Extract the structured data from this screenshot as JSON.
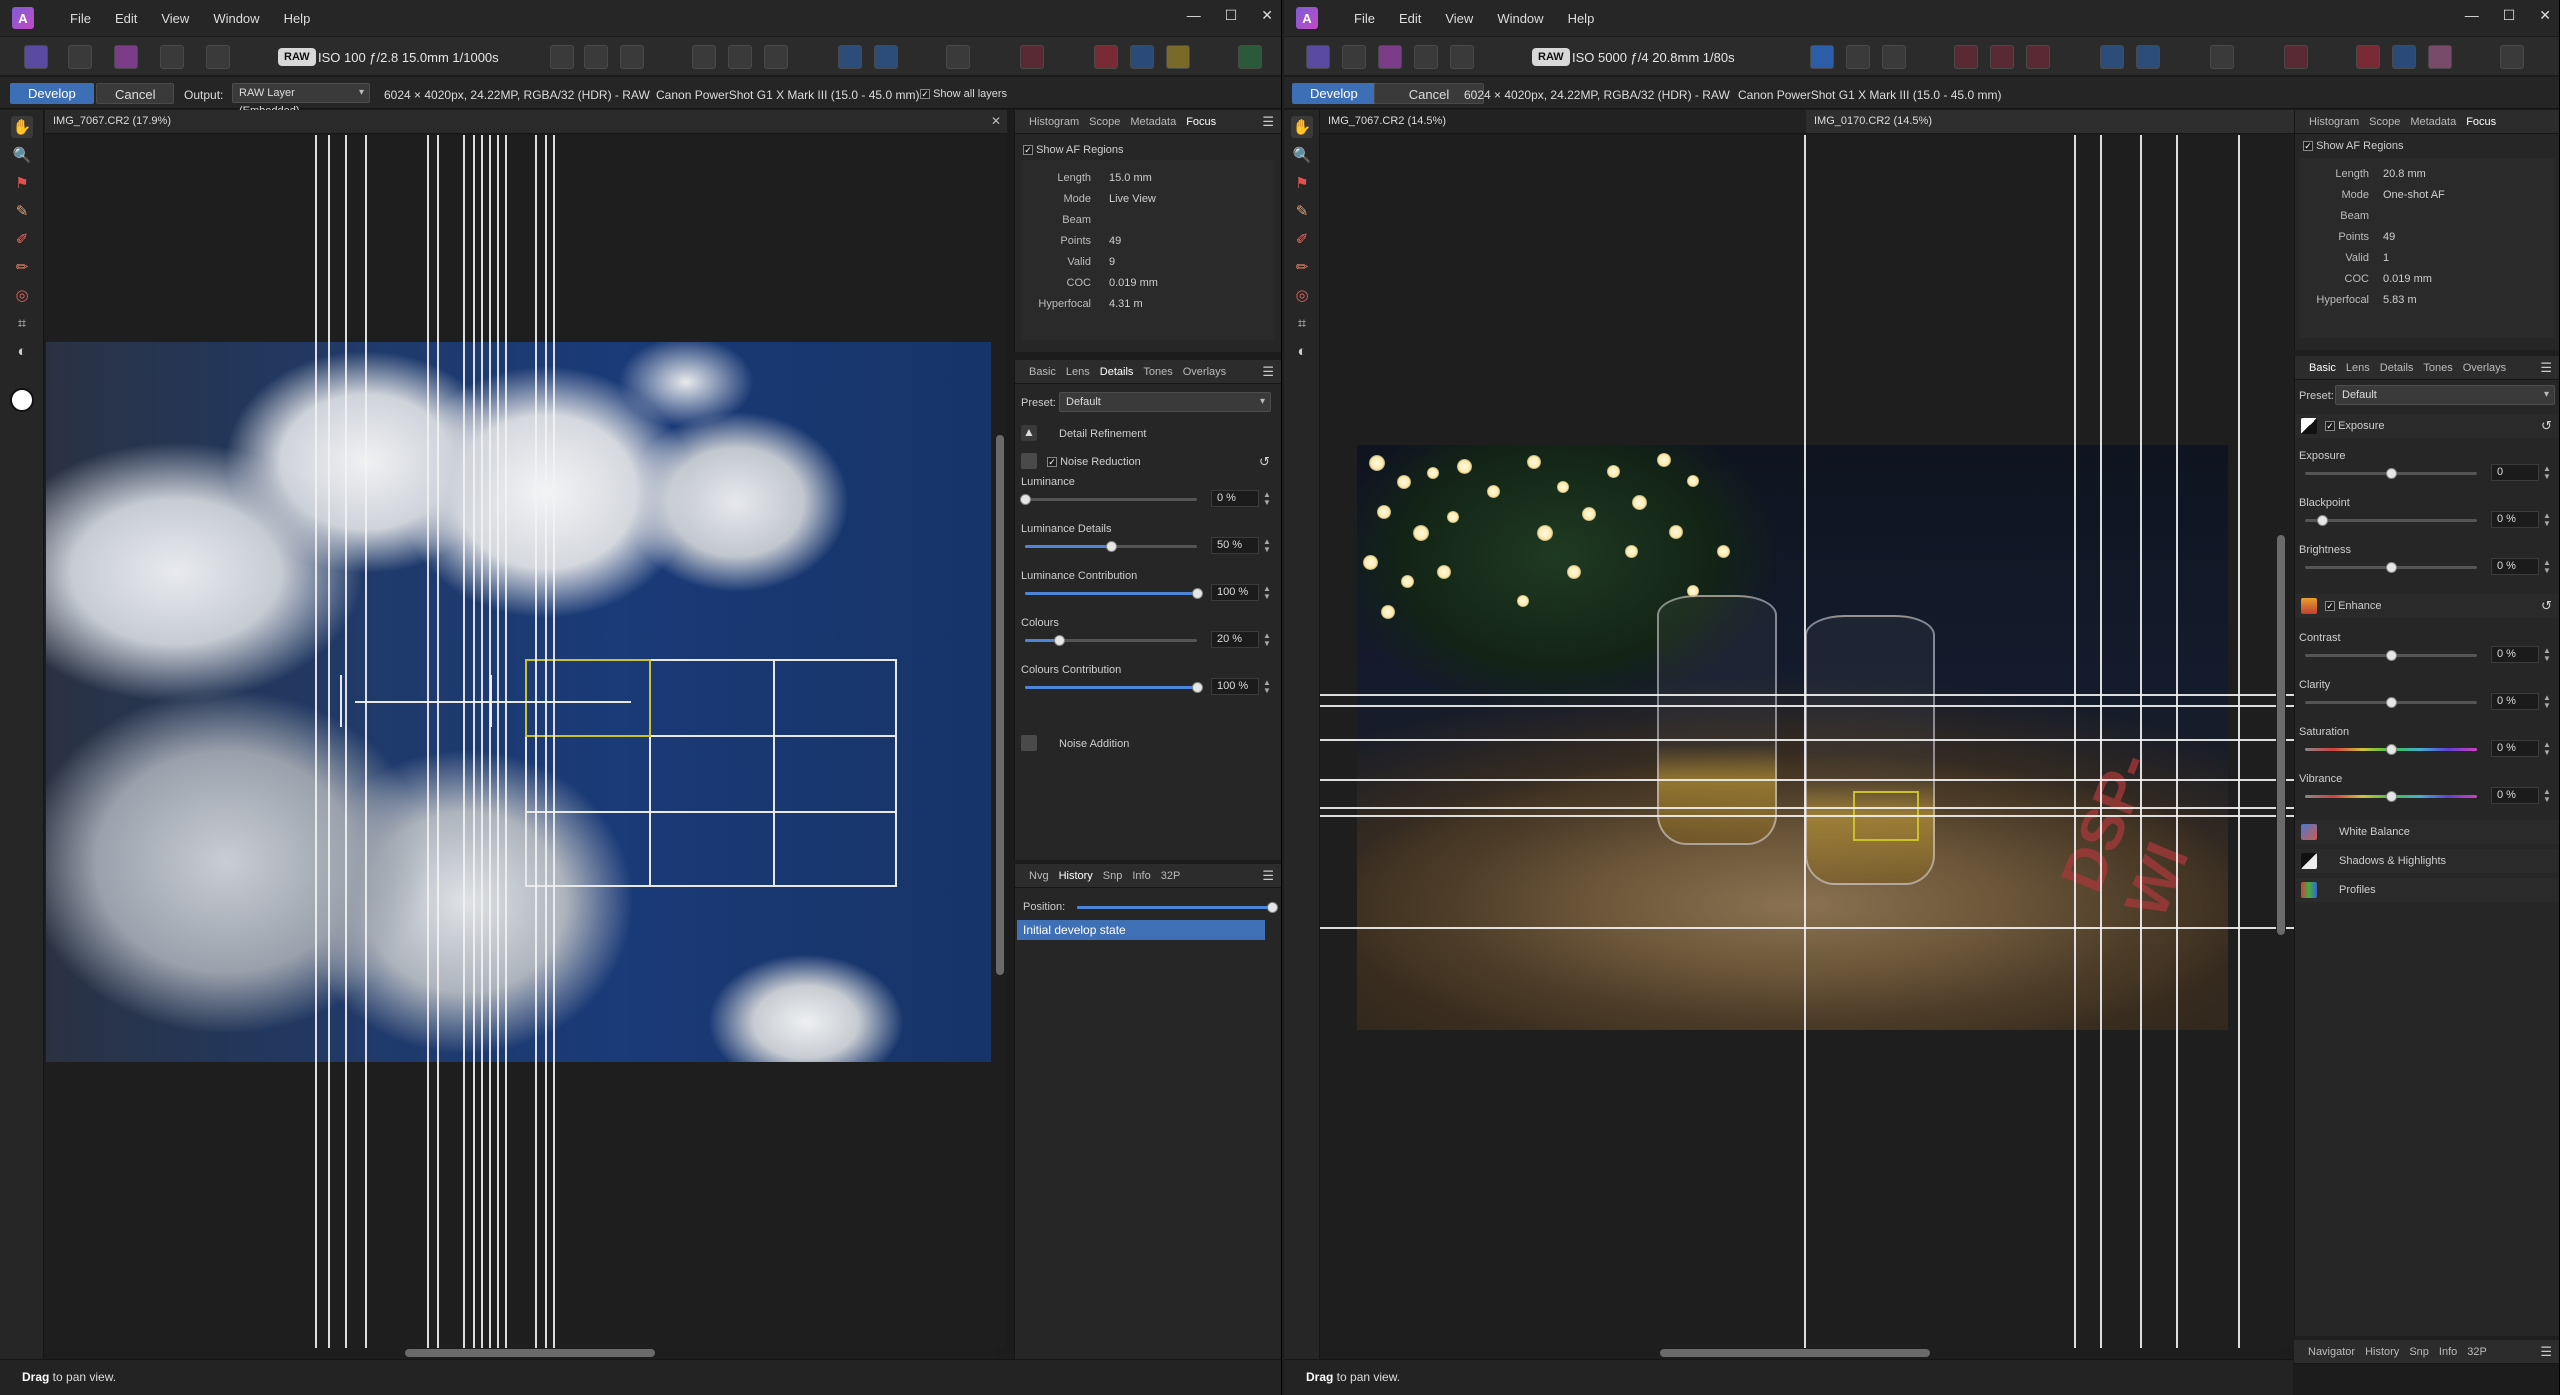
{
  "menu": [
    "File",
    "Edit",
    "View",
    "Window",
    "Help"
  ],
  "window_controls": {
    "minimize": "—",
    "maximize": "☐",
    "close": "✕"
  },
  "left": {
    "exif": "ISO 100 ƒ/2.8 15.0mm 1/1000s",
    "raw_badge": "RAW",
    "develop_label": "Develop",
    "cancel_label": "Cancel",
    "output_label": "Output:",
    "output_value": "RAW Layer (Embedded)",
    "image_info": "6024 × 4020px, 24.22MP, RGBA/32 (HDR) - RAW",
    "camera": "Canon PowerShot G1 X Mark III (15.0 - 45.0 mm)",
    "show_all_layers": "Show all layers",
    "doc_tab": "IMG_7067.CR2 (17.9%)",
    "status_bold": "Drag",
    "status_rest": " to pan view.",
    "top_tabs": [
      "Histogram",
      "Scope",
      "Metadata",
      "Focus"
    ],
    "show_af": "Show AF Regions",
    "focus": [
      {
        "k": "Length",
        "v": "15.0 mm"
      },
      {
        "k": "Mode",
        "v": "Live View"
      },
      {
        "k": "Beam",
        "v": ""
      },
      {
        "k": "Points",
        "v": "49"
      },
      {
        "k": "Valid",
        "v": "9"
      },
      {
        "k": "COC",
        "v": "0.019 mm"
      },
      {
        "k": "Hyperfocal",
        "v": "4.31 m"
      }
    ],
    "mid_tabs": [
      "Basic",
      "Lens",
      "Details",
      "Tones",
      "Overlays"
    ],
    "preset_label": "Preset:",
    "preset_value": "Default",
    "detail_refinement": "Detail Refinement",
    "noise_reduction": "Noise Reduction",
    "sliders": [
      {
        "label": "Luminance",
        "value": "0 %",
        "pos": 0.0
      },
      {
        "label": "Luminance Details",
        "value": "50 %",
        "pos": 0.5
      },
      {
        "label": "Luminance Contribution",
        "value": "100 %",
        "pos": 1.0
      },
      {
        "label": "Colours",
        "value": "20 %",
        "pos": 0.2
      },
      {
        "label": "Colours Contribution",
        "value": "100 %",
        "pos": 1.0
      }
    ],
    "noise_addition": "Noise Addition",
    "bottom_tabs": [
      "Nvg",
      "History",
      "Snp",
      "Info",
      "32P"
    ],
    "position_label": "Position:",
    "history_item": "Initial develop state"
  },
  "right": {
    "exif": "ISO 5000 ƒ/4 20.8mm 1/80s",
    "raw_badge": "RAW",
    "develop_label": "Develop",
    "cancel_label": "Cancel",
    "image_info": "6024 × 4020px, 24.22MP, RGBA/32 (HDR) - RAW",
    "camera": "Canon PowerShot G1 X Mark III (15.0 - 45.0 mm)",
    "doc_tab_1": "IMG_7067.CR2 (14.5%)",
    "doc_tab_2": "IMG_0170.CR2 (14.5%)",
    "status_bold": "Drag",
    "status_rest": " to pan view.",
    "top_tabs": [
      "Histogram",
      "Scope",
      "Metadata",
      "Focus"
    ],
    "show_af": "Show AF Regions",
    "focus": [
      {
        "k": "Length",
        "v": "20.8 mm"
      },
      {
        "k": "Mode",
        "v": "One-shot AF"
      },
      {
        "k": "Beam",
        "v": ""
      },
      {
        "k": "Points",
        "v": "49"
      },
      {
        "k": "Valid",
        "v": "1"
      },
      {
        "k": "COC",
        "v": "0.019 mm"
      },
      {
        "k": "Hyperfocal",
        "v": "5.83 m"
      }
    ],
    "mid_tabs": [
      "Basic",
      "Lens",
      "Details",
      "Tones",
      "Overlays"
    ],
    "preset_label": "Preset:",
    "preset_value": "Default",
    "exposure_section": "Exposure",
    "exposure_sliders": [
      {
        "label": "Exposure",
        "value": "0",
        "pos": 0.5
      },
      {
        "label": "Blackpoint",
        "value": "0 %",
        "pos": 0.1
      },
      {
        "label": "Brightness",
        "value": "0 %",
        "pos": 0.5
      }
    ],
    "enhance_section": "Enhance",
    "enhance_sliders": [
      {
        "label": "Contrast",
        "value": "0 %",
        "pos": 0.5
      },
      {
        "label": "Clarity",
        "value": "0 %",
        "pos": 0.5
      },
      {
        "label": "Saturation",
        "value": "0 %",
        "pos": 0.5
      },
      {
        "label": "Vibrance",
        "value": "0 %",
        "pos": 0.5
      }
    ],
    "white_balance": "White Balance",
    "shadows_highlights": "Shadows & Highlights",
    "profiles": "Profiles",
    "bottom_tabs": [
      "Navigator",
      "History",
      "Snp",
      "Info",
      "32P"
    ],
    "photo_text": "DSP-WI"
  }
}
